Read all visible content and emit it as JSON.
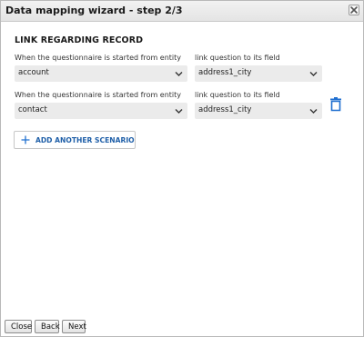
{
  "window": {
    "title": "Data mapping wizard - step 2/3"
  },
  "section": {
    "title": "LINK REGARDING RECORD"
  },
  "scenarios": [
    {
      "entity_label": "When the questionnaire is started from entity",
      "entity_value": "account",
      "field_label": "link question to its field",
      "field_value": "address1_city"
    },
    {
      "entity_label": "When the questionnaire is started from entity",
      "entity_value": "contact",
      "field_label": "link question to its field",
      "field_value": "address1_city"
    }
  ],
  "actions": {
    "add_scenario_label": "ADD ANOTHER SCENARIO"
  },
  "footer": {
    "close_label": "Close",
    "back_label": "Back",
    "next_label": "Next"
  },
  "colors": {
    "accent": "#1f6fd0",
    "select_bg": "#ebebeb"
  },
  "icons": {
    "close": "close-icon",
    "chevron": "chevron-down-icon",
    "delete": "trash-icon",
    "add": "plus-icon"
  }
}
